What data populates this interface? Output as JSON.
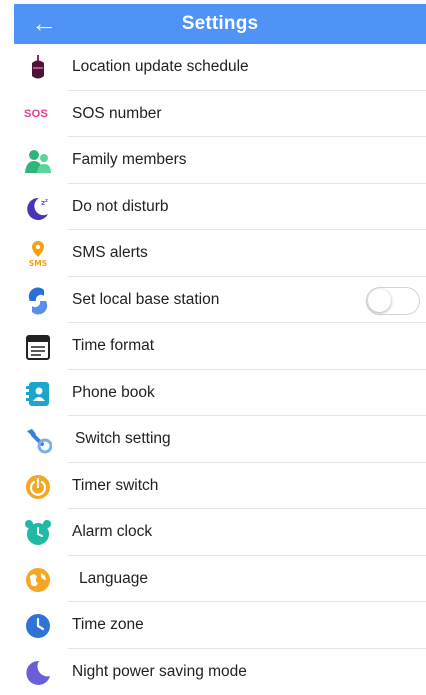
{
  "header": {
    "title": "Settings",
    "back_icon": "arrow-left-icon",
    "color": "#4f93f7"
  },
  "items": [
    {
      "label": "Location update schedule",
      "icon": "location-device-icon"
    },
    {
      "label": "SOS number",
      "icon": "sos-icon",
      "icon_text": "SOS"
    },
    {
      "label": "Family members",
      "icon": "family-members-icon"
    },
    {
      "label": "Do not disturb",
      "icon": "moon-zz-icon"
    },
    {
      "label": "SMS alerts",
      "icon": "sms-alert-icon",
      "icon_text": "SMS"
    },
    {
      "label": "Set local base station",
      "icon": "base-station-icon",
      "toggle": false
    },
    {
      "label": "Time format",
      "icon": "calendar-format-icon"
    },
    {
      "label": "Phone book",
      "icon": "phone-book-icon"
    },
    {
      "label": "Switch setting",
      "icon": "wrench-switch-icon"
    },
    {
      "label": "Timer switch",
      "icon": "timer-power-icon"
    },
    {
      "label": "Alarm clock",
      "icon": "alarm-clock-icon"
    },
    {
      "label": "Language",
      "icon": "language-icon"
    },
    {
      "label": "Time zone",
      "icon": "clock-icon"
    },
    {
      "label": "Night power saving mode",
      "icon": "night-moon-icon"
    }
  ]
}
